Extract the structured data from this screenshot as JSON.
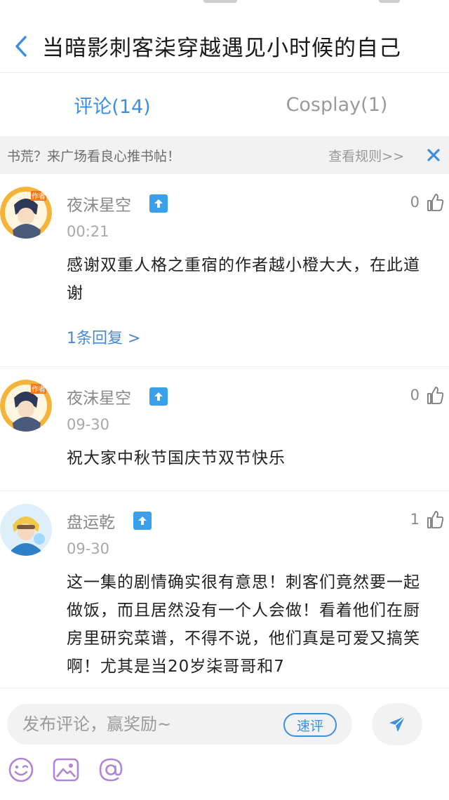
{
  "colors": {
    "accent": "#3c8fe0",
    "text_muted": "#888888",
    "badge": "#3aa0ec",
    "icon_purple": "#b084d8"
  },
  "header": {
    "title": "当暗影刺客柒穿越遇见小时候的自己",
    "back_icon": "chevron-left-icon"
  },
  "tabs": [
    {
      "label": "评论(14)",
      "active": true
    },
    {
      "label": "Cosplay(1)",
      "active": false
    }
  ],
  "notice": {
    "text": "书荒？来广场看良心推书帖！",
    "link": "查看规则>>",
    "close_icon": "close-icon"
  },
  "comments": [
    {
      "user": "夜沫星空",
      "avatar_badge": "作者",
      "time": "00:21",
      "likes": "0",
      "text": "感谢双重人格之重宿的作者越小橙大大，在此道谢",
      "reply": "1条回复 >"
    },
    {
      "user": "夜沫星空",
      "avatar_badge": "作者",
      "time": "09-30",
      "likes": "0",
      "text": "祝大家中秋节国庆节双节快乐"
    },
    {
      "user": "盘运乾",
      "time": "09-30",
      "likes": "1",
      "text": "这一集的剧情确实很有意思！刺客们竟然要一起做饭，而且居然没有一个人会做！看着他们在厨房里研究菜谱，不得不说，他们真是可爱又搞笑啊！尤其是当20岁柒哥哥和7"
    }
  ],
  "composer": {
    "placeholder": "发布评论，赢奖励~",
    "quick_review": "速评",
    "send_icon": "send-icon",
    "tools": [
      "emoji-icon",
      "image-icon",
      "at-icon"
    ]
  }
}
